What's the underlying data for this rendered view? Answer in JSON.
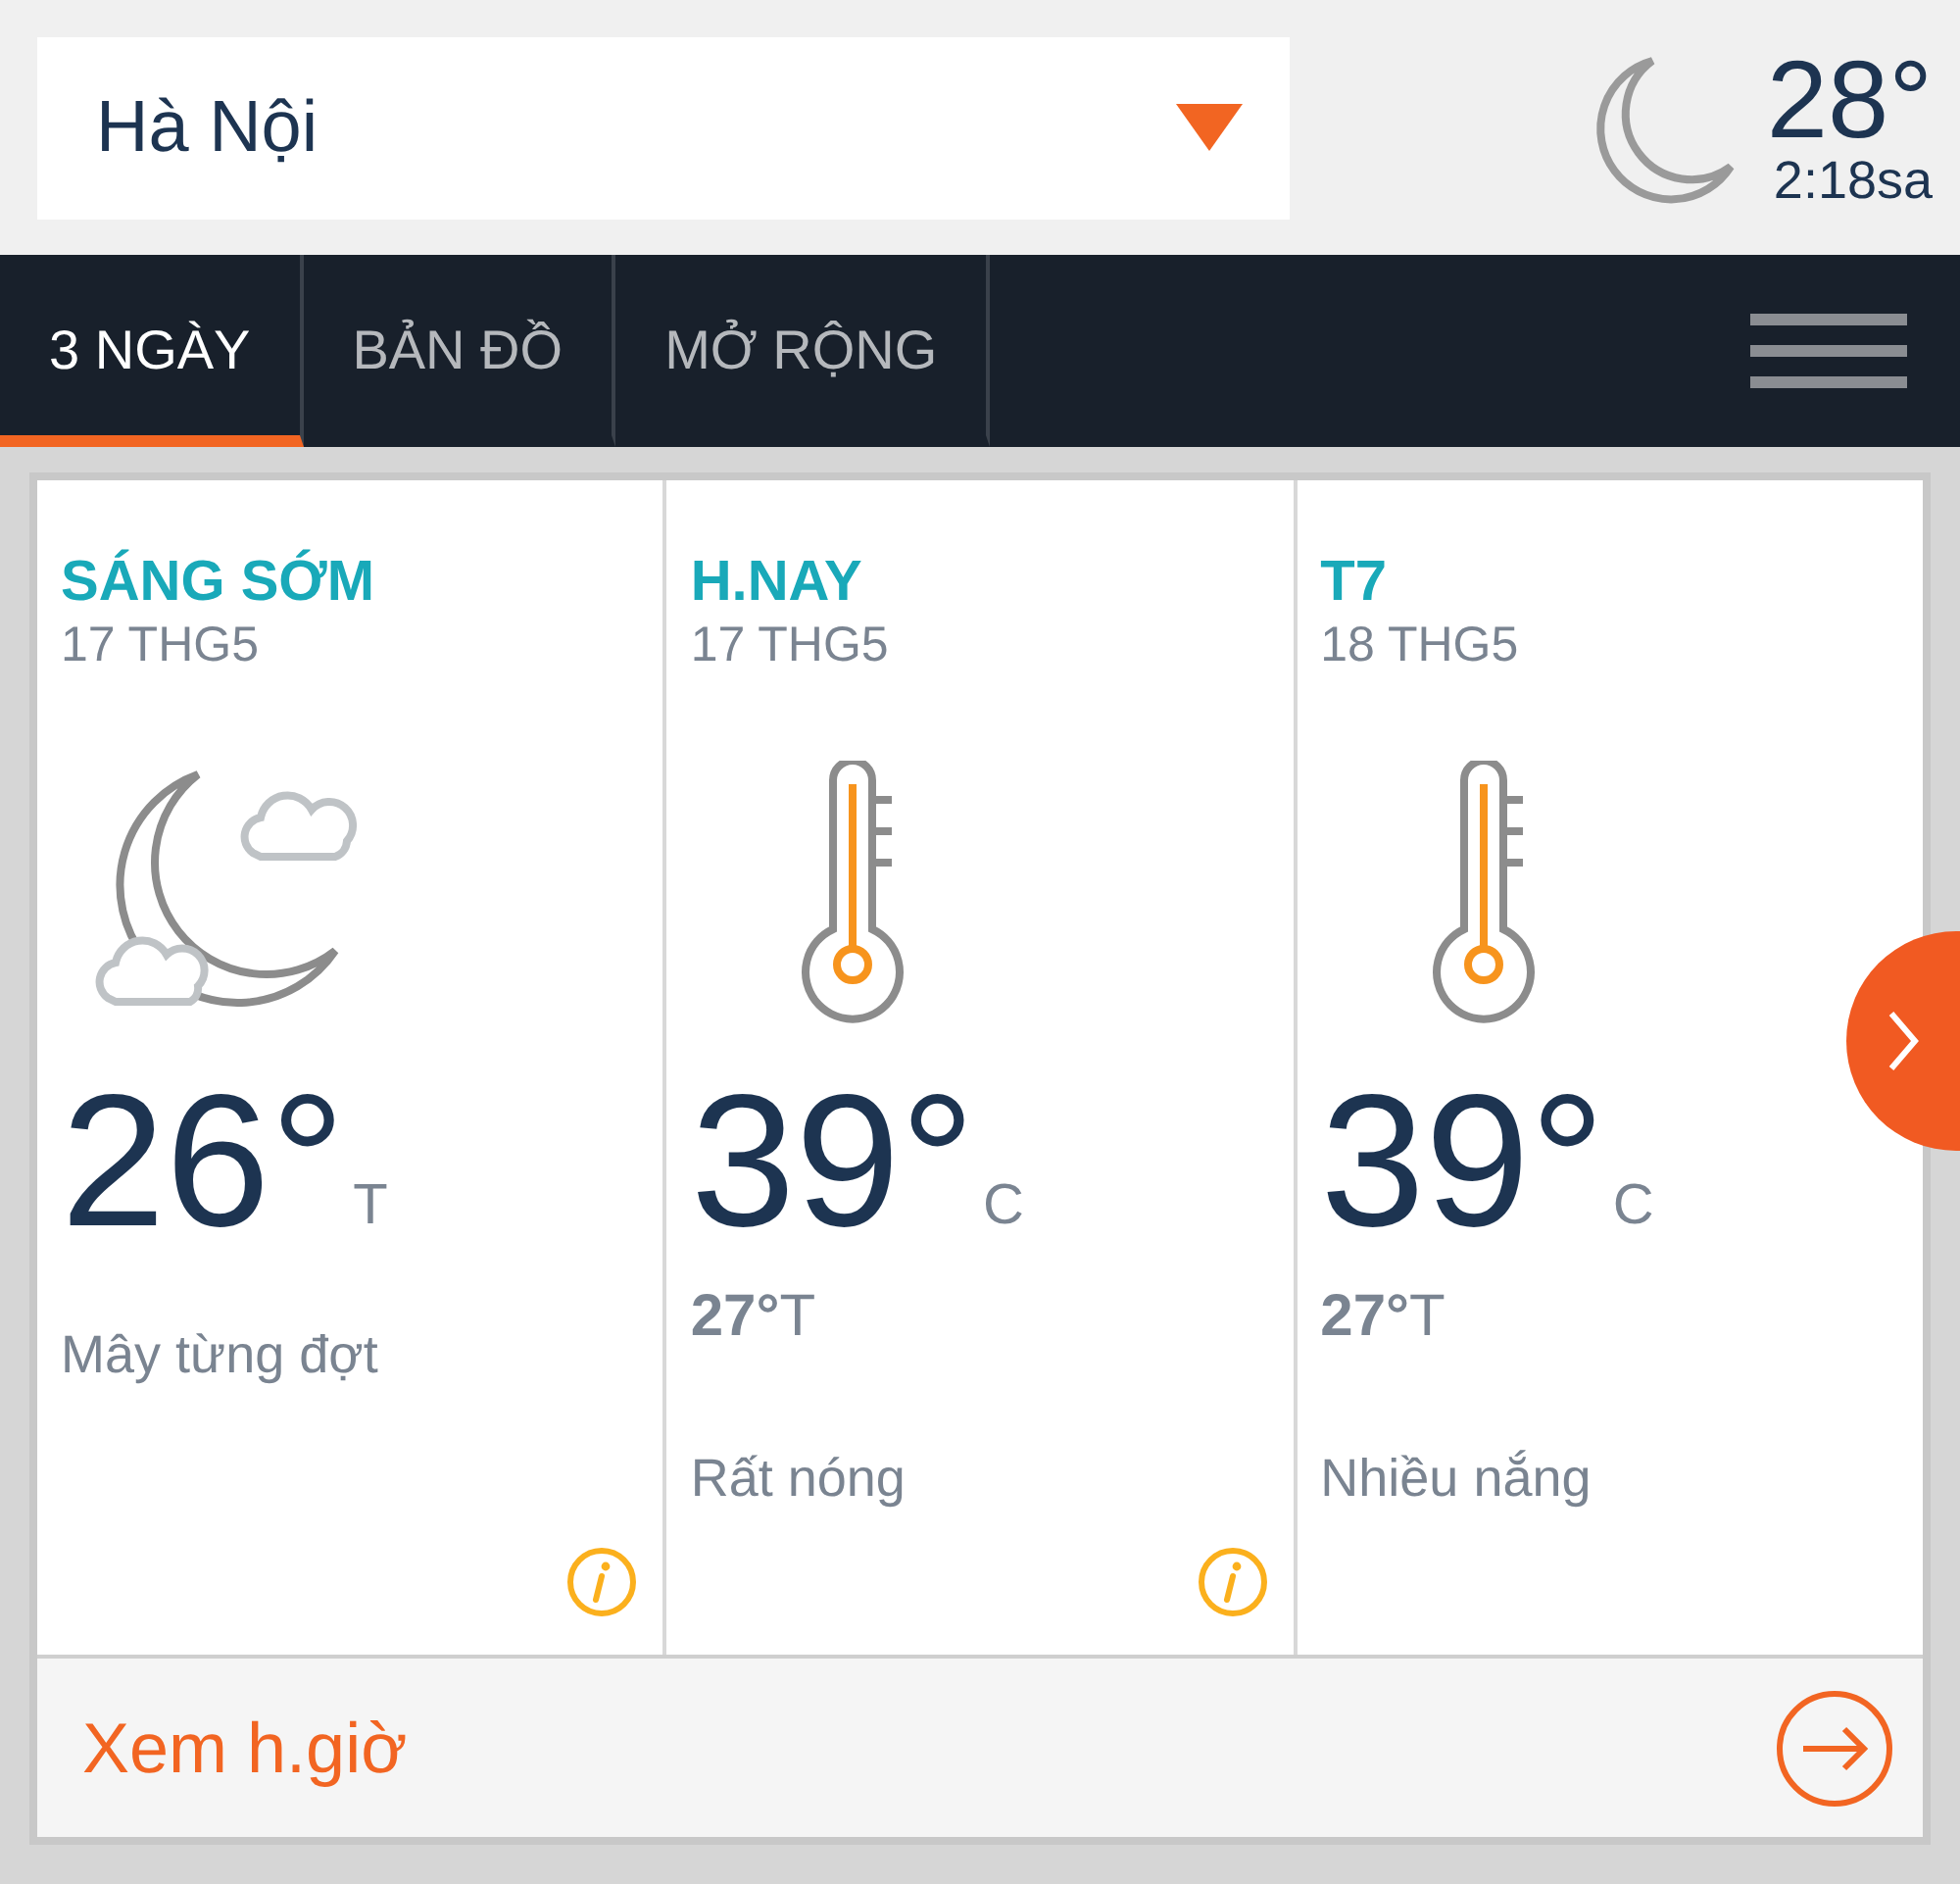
{
  "location": {
    "value": "Hà Nội"
  },
  "current": {
    "temp": "28°",
    "time": "2:18sa"
  },
  "tabs": [
    {
      "label": "3 NGÀY",
      "selected": true
    },
    {
      "label": "BẢN ĐỒ",
      "selected": false
    },
    {
      "label": "MỞ RỘNG",
      "selected": false
    }
  ],
  "days": [
    {
      "kind": "night-cloudy",
      "title": "SÁNG SỚM",
      "date": "17 THG5",
      "temp": "26°",
      "unit": "T",
      "condition": "Mây từng đợt",
      "info": true
    },
    {
      "kind": "hot",
      "title": "H.NAY",
      "date": "17 THG5",
      "temp": "39°",
      "unit": "C",
      "low": "**27°**T",
      "condition": "Rất nóng",
      "info": true
    },
    {
      "kind": "hot",
      "title": "T7",
      "date": "18 THG5",
      "temp": "39°",
      "unit": "C",
      "low": "**27°**T",
      "condition": "Nhiều nắng",
      "info": false
    }
  ],
  "hourly_link": {
    "label": "Xem h.giờ"
  }
}
